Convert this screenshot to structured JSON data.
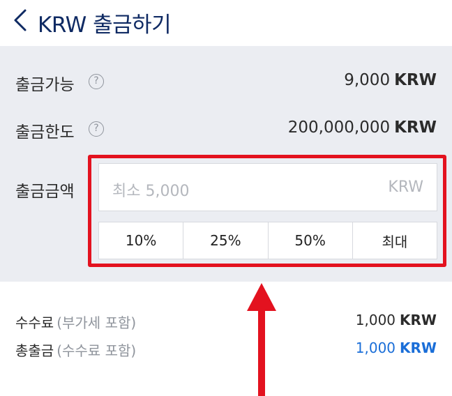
{
  "header": {
    "title": "KRW 출금하기",
    "back_icon": "chevron-left-icon"
  },
  "rows": {
    "available": {
      "label": "출금가능",
      "value": "9,000",
      "unit": "KRW",
      "help_glyph": "?"
    },
    "limit": {
      "label": "출금한도",
      "value": "200,000,000",
      "unit": "KRW",
      "help_glyph": "?"
    },
    "amount": {
      "label": "출금금액",
      "placeholder": "최소 5,000",
      "unit": "KRW"
    }
  },
  "quick_buttons": [
    "10%",
    "25%",
    "50%",
    "최대"
  ],
  "fee": {
    "label": "수수료",
    "sub": "(부가세 포함)",
    "value": "1,000",
    "unit": "KRW"
  },
  "total": {
    "label": "총출금",
    "sub": "(수수료 포함)",
    "value": "1,000",
    "unit": "KRW"
  },
  "colors": {
    "title": "#0f2a63",
    "panel_bg": "#ebedf2",
    "highlight": "#e3121f",
    "accent_blue": "#1a6ed8"
  }
}
